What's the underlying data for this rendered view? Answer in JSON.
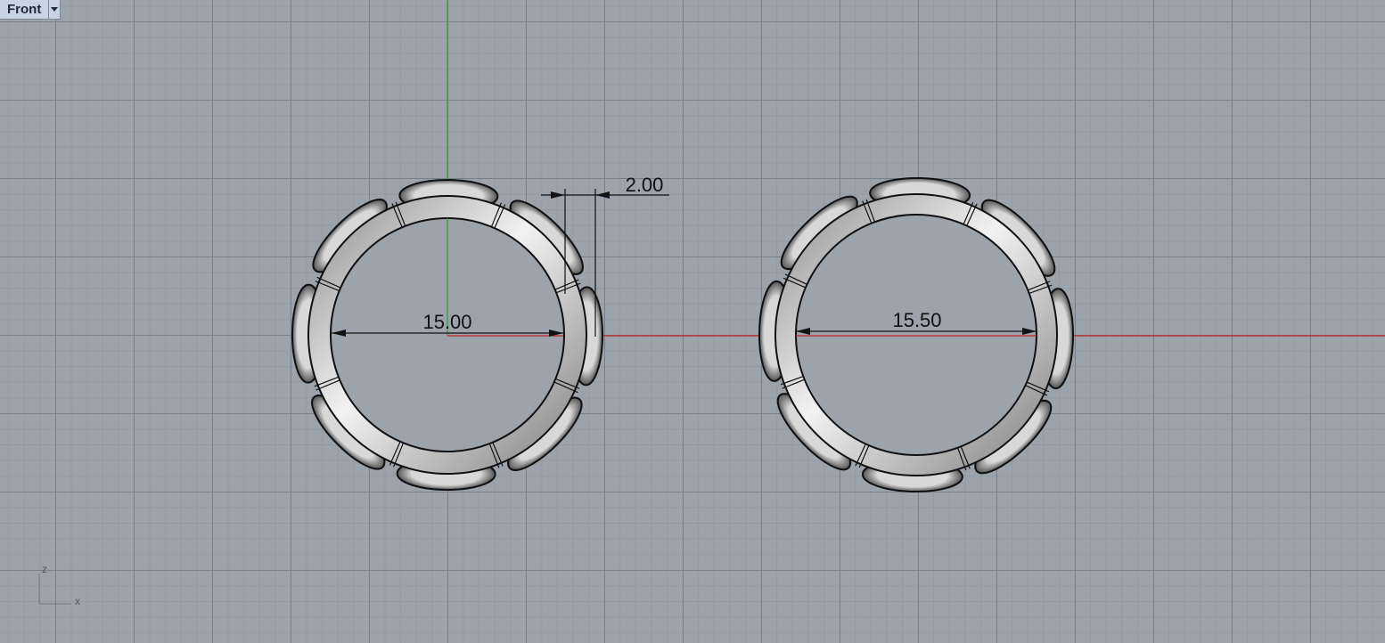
{
  "viewport": {
    "name": "Front",
    "background": "#9ca3ab",
    "x_axis_color": "#c02525",
    "y_axis_color": "#2ea02e"
  },
  "dimensions": {
    "left_ring_diameter": "15.00",
    "right_ring_diameter": "15.50",
    "band_width": "2.00"
  },
  "axis_icon": {
    "vertical_label": "z",
    "horizontal_label": "x"
  }
}
